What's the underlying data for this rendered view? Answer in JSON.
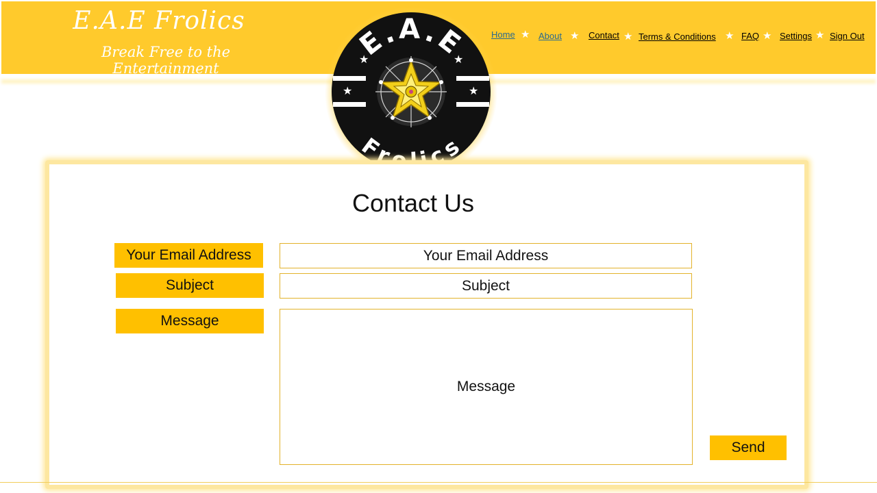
{
  "site": {
    "title": "E.A.E Frolics",
    "tagline": "Break Free to the Entertainment"
  },
  "logo": {
    "top_text": "E.A.E",
    "bottom_text": "Frolics"
  },
  "nav": {
    "items": [
      {
        "label": "Home"
      },
      {
        "label": "About"
      },
      {
        "label": "Contact"
      },
      {
        "label": "Terms & Conditions"
      },
      {
        "label": "FAQ"
      },
      {
        "label": "Settings"
      },
      {
        "label": "Sign Out"
      }
    ],
    "separator_icon": "star-icon"
  },
  "page": {
    "title": "Contact Us"
  },
  "form": {
    "email": {
      "label": "Your Email Address",
      "placeholder": "Your Email Address"
    },
    "subject": {
      "label": "Subject",
      "placeholder": "Subject"
    },
    "message": {
      "label": "Message",
      "placeholder": "Message"
    },
    "send_label": "Send"
  },
  "colors": {
    "header_bg": "#ffca2c",
    "accent": "#ffc000",
    "link_visited": "#2a6a8e"
  }
}
